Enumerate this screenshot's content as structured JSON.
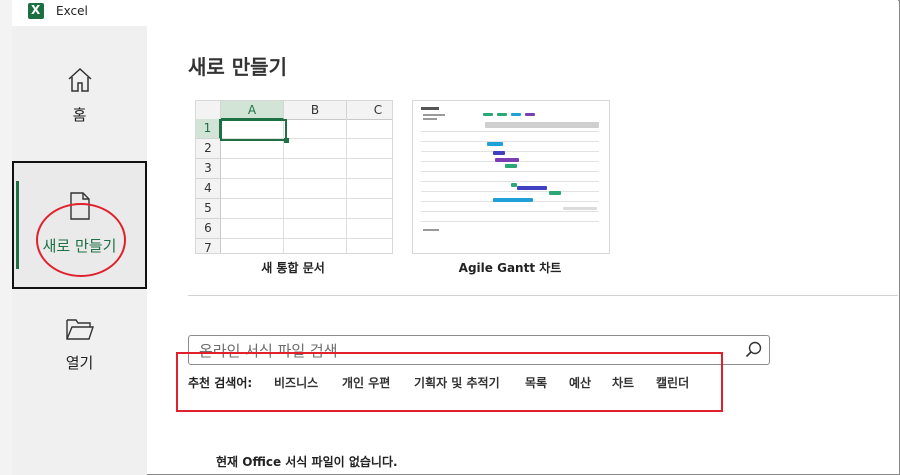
{
  "app": {
    "title": "Excel",
    "logo_letter": "X"
  },
  "leftnav": {
    "items": [
      {
        "label": "홈",
        "icon": "home-icon"
      },
      {
        "label": "새로 만들기",
        "icon": "new-document-icon",
        "selected": true
      },
      {
        "label": "열기",
        "icon": "folder-open-icon"
      }
    ]
  },
  "main": {
    "title": "새로 만들기",
    "templates": [
      {
        "name": "새 통합 문서"
      },
      {
        "name": "Agile Gantt 차트"
      }
    ],
    "blank_grid": {
      "columns": [
        "A",
        "B",
        "C"
      ],
      "rows": [
        "1",
        "2",
        "3",
        "4",
        "5",
        "6",
        "7"
      ]
    },
    "search": {
      "placeholder": "온라인 서식 파일 검색",
      "value": ""
    },
    "suggested": {
      "label": "추천 검색어:",
      "items": [
        "비즈니스",
        "개인 우편",
        "기획자 및 추적기",
        "목록",
        "예산",
        "차트",
        "캘린더"
      ]
    },
    "empty_message": "현재 Office 서식 파일이 없습니다."
  },
  "colors": {
    "accent": "#1e7145",
    "annotation": "#e0202b",
    "nav_bg": "#f0f0f0"
  }
}
